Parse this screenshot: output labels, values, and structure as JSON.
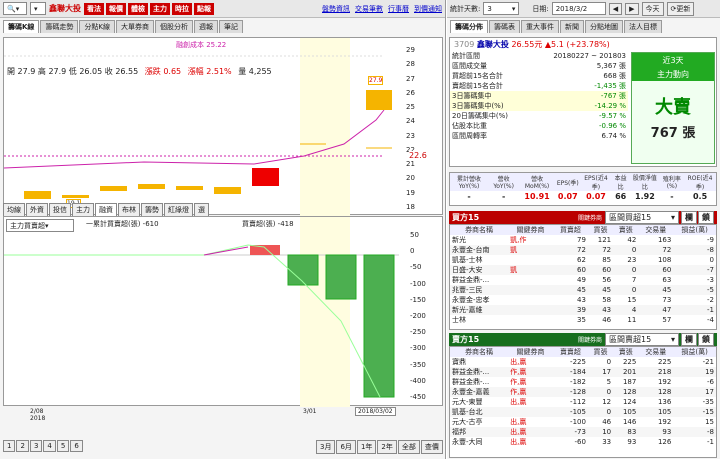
{
  "toolbar": {
    "stock": "鑫聯大投",
    "buttons": [
      "看法",
      "報價",
      "體檢",
      "主力",
      "時拉",
      "點報"
    ],
    "links": [
      "盤勢資訊",
      "交易筆數",
      "行事曆",
      "到價通知"
    ]
  },
  "tabs_left": [
    "籌碼K線",
    "籌碼走勢",
    "分點K線",
    "大單券商",
    "個股分析",
    "週報",
    "筆記"
  ],
  "chart": {
    "label": "融創成本 25.22",
    "stats": "開 27.9  高 27.9  低 26.05  收 26.55",
    "chg": "漲跌 0.65",
    "pct": "漲幅 2.51%",
    "vol": "量 4,255",
    "ticks": [
      "29",
      "28",
      "27",
      "26",
      "25",
      "24",
      "23",
      "22",
      "21",
      "20",
      "19",
      "18"
    ],
    "price_tag": "22.6",
    "box_hi": "27.9",
    "box_lo": "19.1"
  },
  "sub_tabs": [
    "均線",
    "外資",
    "投信",
    "主力",
    "融資",
    "布林",
    "籌勢",
    "紅綠燈",
    "選"
  ],
  "indicator": {
    "select": "主力買賣超",
    "legend1": "一累計買賣超(張) -610",
    "legend2": "買賣超(張) -418",
    "ticks": [
      "50",
      "0",
      "-50",
      "-100",
      "-150",
      "-200",
      "-250",
      "-300",
      "-350",
      "-400",
      "-450"
    ]
  },
  "dates": {
    "d1": "2/08",
    "d1y": "2018",
    "d2": "3/01",
    "d3": "2018/03/02"
  },
  "pager": [
    "1",
    "2",
    "3",
    "4",
    "5",
    "6"
  ],
  "ranges": [
    "3月",
    "6月",
    "1年",
    "2年",
    "全部",
    "查價"
  ],
  "right_top": {
    "label_days": "統計天數:",
    "days": "3",
    "label_date": "日期:",
    "date": "2018/3/2",
    "today": "今天",
    "refresh": "更新"
  },
  "right_tabs": [
    "籌碼分佈",
    "籌碼表",
    "重大事件",
    "新聞",
    "分點地圖",
    "法人目標"
  ],
  "quote": {
    "code": "3709",
    "name": "鑫聯大投",
    "price": "26.55元",
    "chg": "▲5.1 (+23.78%)"
  },
  "summary": [
    [
      "統計區間",
      "20180227 ~ 201803"
    ],
    [
      "區間成交量",
      "5,367 張"
    ],
    [
      "買超前15名合計",
      "668 張"
    ],
    [
      "賣超前15名合計",
      "-1,435 張"
    ],
    [
      "3日籌碼集中",
      "-767 張"
    ],
    [
      "3日籌碼集中(%)",
      "-14.29 %"
    ],
    [
      "20日籌碼集中(%)",
      "-9.57 %"
    ],
    [
      "佔股本比重",
      "-0.96 %"
    ],
    [
      "區間周轉率",
      "6.74 %"
    ]
  ],
  "side": {
    "title": "近3天",
    "sub": "主力動向",
    "verdict": "大賣",
    "amount": "767 張"
  },
  "fin": {
    "heads": [
      "累計營收YoY(%)",
      "營收YoY(%)",
      "營收MoM(%)",
      "EPS(季)",
      "EPS(近4季)",
      "本益比",
      "股價淨值比",
      "殖利率(%)",
      "ROE(近4季)"
    ],
    "vals": [
      "-",
      "-",
      "10.91",
      "0.07",
      "0.07",
      "66",
      "1.92",
      "-",
      "0.5"
    ]
  },
  "buy": {
    "title": "買方15",
    "hint": "關鍵券商",
    "select": "區間買超15",
    "heads": [
      "券商名稱",
      "關鍵券商",
      "買賣超",
      "買張",
      "賣張",
      "交易量",
      "損益(萬)"
    ],
    "rows": [
      [
        "新光",
        "凱,作",
        "79",
        "121",
        "42",
        "163",
        "-9"
      ],
      [
        "永豐金-台南",
        "凱",
        "72",
        "72",
        "0",
        "72",
        "-8"
      ],
      [
        "凱基-士林",
        "",
        "62",
        "85",
        "23",
        "108",
        "0"
      ],
      [
        "日盛-大安",
        "凱",
        "60",
        "60",
        "0",
        "60",
        "-7"
      ],
      [
        "群益金鼎-...",
        "",
        "49",
        "56",
        "7",
        "63",
        "-3"
      ],
      [
        "兆豐-三民",
        "",
        "45",
        "45",
        "0",
        "45",
        "-5"
      ],
      [
        "永豐金-忠孝",
        "",
        "43",
        "58",
        "15",
        "73",
        "-2"
      ],
      [
        "新光-嘉維",
        "",
        "39",
        "43",
        "4",
        "47",
        "-1"
      ],
      [
        "士林",
        "",
        "35",
        "46",
        "11",
        "57",
        "-4"
      ]
    ]
  },
  "sell": {
    "title": "賣方15",
    "hint": "關鍵券商",
    "select": "區間賣超15",
    "heads": [
      "券商名稱",
      "關鍵券商",
      "賣賣超",
      "買張",
      "賣張",
      "交易量",
      "損益(萬)"
    ],
    "rows": [
      [
        "寶鼎",
        "出,贏",
        "-225",
        "0",
        "225",
        "225",
        "-21"
      ],
      [
        "群益金鼎-...",
        "作,贏",
        "-184",
        "17",
        "201",
        "218",
        "19"
      ],
      [
        "群益金鼎-...",
        "作,贏",
        "-182",
        "5",
        "187",
        "192",
        "-6"
      ],
      [
        "永豐金-嘉義",
        "作,贏",
        "-128",
        "0",
        "128",
        "128",
        "17"
      ],
      [
        "元大-東豐",
        "出,贏",
        "-112",
        "12",
        "124",
        "136",
        "-35"
      ],
      [
        "凱基-台北",
        "",
        "-105",
        "0",
        "105",
        "105",
        "-15"
      ],
      [
        "元大-古亭",
        "出,贏",
        "-100",
        "46",
        "146",
        "192",
        "15"
      ],
      [
        "福邦",
        "出,贏",
        "-73",
        "10",
        "83",
        "93",
        "-8"
      ],
      [
        "永豐-大同",
        "出,贏",
        "-60",
        "33",
        "93",
        "126",
        "-1"
      ]
    ]
  }
}
